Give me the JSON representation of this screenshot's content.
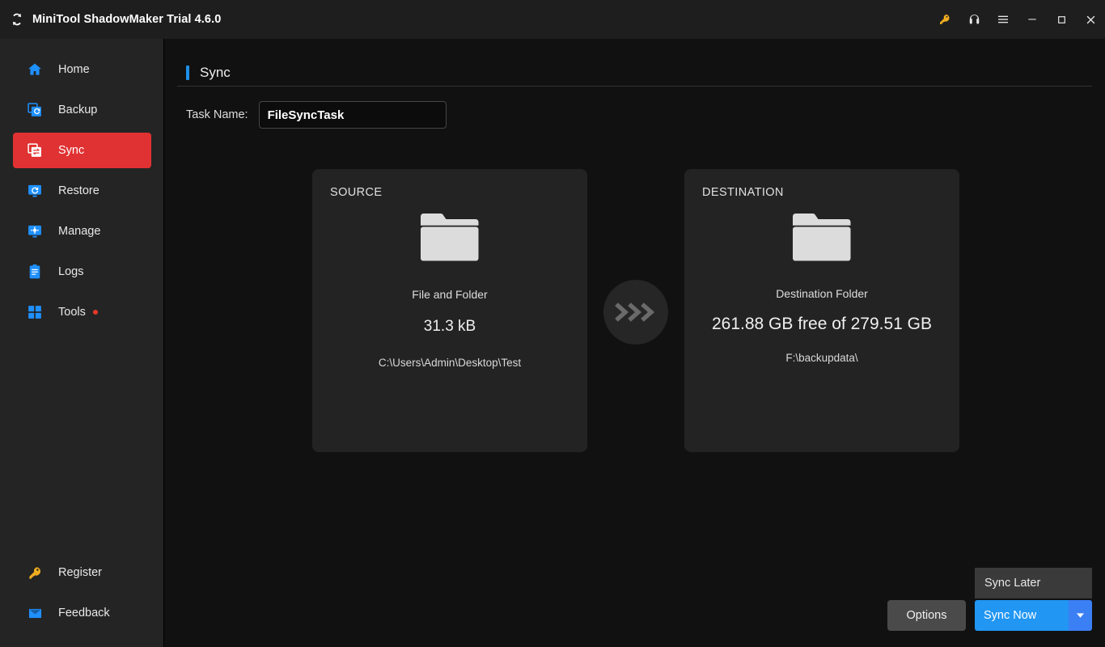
{
  "titlebar": {
    "app_title": "MiniTool ShadowMaker Trial 4.6.0",
    "logo_icon": "sync-logo-icon",
    "buttons": [
      {
        "name": "key-icon",
        "label": ""
      },
      {
        "name": "headset-icon",
        "label": ""
      },
      {
        "name": "hamburger-menu-icon",
        "label": ""
      },
      {
        "name": "minimize-icon",
        "label": ""
      },
      {
        "name": "maximize-icon",
        "label": ""
      },
      {
        "name": "close-icon",
        "label": ""
      }
    ]
  },
  "sidebar": {
    "items": [
      {
        "label": "Home",
        "icon": "home-icon",
        "active": false,
        "badge": false
      },
      {
        "label": "Backup",
        "icon": "backup-icon",
        "active": false,
        "badge": false
      },
      {
        "label": "Sync",
        "icon": "sync-icon",
        "active": true,
        "badge": false
      },
      {
        "label": "Restore",
        "icon": "restore-icon",
        "active": false,
        "badge": false
      },
      {
        "label": "Manage",
        "icon": "manage-icon",
        "active": false,
        "badge": false
      },
      {
        "label": "Logs",
        "icon": "logs-icon",
        "active": false,
        "badge": false
      },
      {
        "label": "Tools",
        "icon": "tools-icon",
        "active": false,
        "badge": true
      }
    ],
    "bottom_items": [
      {
        "label": "Register",
        "icon": "key-icon"
      },
      {
        "label": "Feedback",
        "icon": "envelope-icon"
      }
    ],
    "active_color": "#e03232",
    "icon_color": "#1e90ff",
    "badge_color": "#e8392b"
  },
  "page": {
    "title": "Sync",
    "accent_color": "#1e8fe8"
  },
  "task": {
    "label": "Task Name:",
    "value": "FileSyncTask",
    "placeholder": "Task Name"
  },
  "source": {
    "heading": "SOURCE",
    "icon": "folder-icon",
    "kind": "File and Folder",
    "size": "31.3 kB",
    "path": "C:\\Users\\Admin\\Desktop\\Test"
  },
  "destination": {
    "heading": "DESTINATION",
    "icon": "folder-icon",
    "kind": "Destination Folder",
    "size": "261.88 GB free of 279.51 GB",
    "path": "F:\\backupdata\\"
  },
  "transfer": {
    "icon": "chevrons-right-icon"
  },
  "actions": {
    "sync_later": "Sync Later",
    "options": "Options",
    "sync_now": "Sync Now",
    "caret_icon": "chevron-down-icon",
    "primary_color": "#2196f3"
  }
}
